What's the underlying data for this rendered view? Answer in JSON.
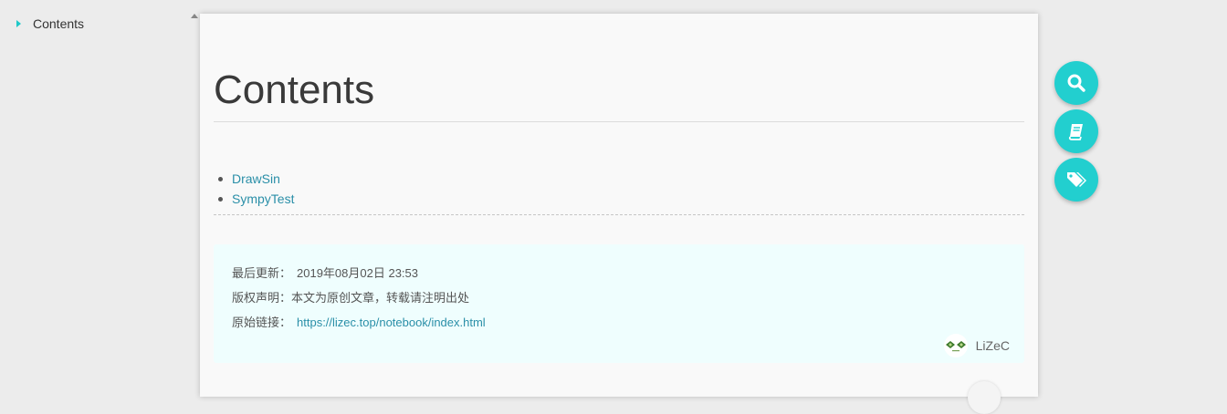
{
  "toc": {
    "items": [
      {
        "label": "Contents"
      }
    ]
  },
  "article": {
    "title": "Contents",
    "links": [
      {
        "label": "DrawSin"
      },
      {
        "label": "SympyTest"
      }
    ],
    "copyright": {
      "updated_label": "最后更新：",
      "updated_value": "2019年08月02日 23:53",
      "license_label": "版权声明",
      "license_sep": "：",
      "license_value": "本文为原创文章，转载请注明出处",
      "link_label": "原始链接：",
      "link_value": "https://lizec.top/notebook/index.html",
      "author": "LiZeC"
    }
  },
  "fabs": [
    {
      "icon": "search-icon"
    },
    {
      "icon": "book-icon"
    },
    {
      "icon": "tags-icon"
    }
  ],
  "colors": {
    "accent": "#22cfcf",
    "link": "#2a8fa8",
    "copyright_bg": "#effefe"
  }
}
